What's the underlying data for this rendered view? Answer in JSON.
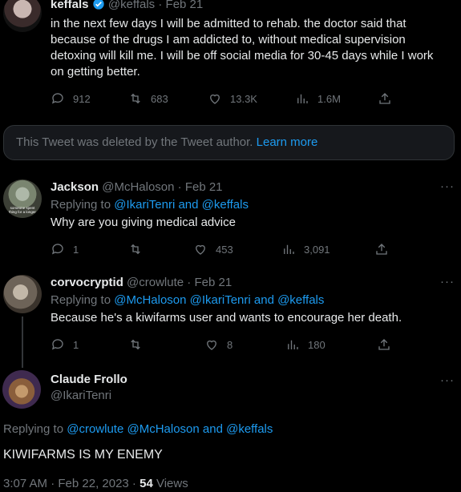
{
  "main_tweet": {
    "name": "keffals",
    "handle": "@keffals",
    "date": "Feb 21",
    "text_lines": [
      "in the next few days I will be admitted to rehab. the doctor said that",
      "because of the drugs I am addicted to, without medical supervision",
      "detoxing will kill me. I will be off social media for 30-45 days while I work",
      "on getting better."
    ],
    "replies": "912",
    "retweets": "683",
    "likes": "13.3K",
    "views": "1.6M"
  },
  "deleted": {
    "text": "This Tweet was deleted by the Tweet author.",
    "link": "Learn more"
  },
  "reply1": {
    "name": "Jackson",
    "handle": "@McHaloson",
    "date": "Feb 21",
    "replying_prefix": "Replying to ",
    "replying_to": "@IkariTenri and @keffals",
    "text": "Why are you giving medical advice",
    "replies": "1",
    "likes": "453",
    "views": "3,091",
    "avatar_caption": "someone spent thing for a longer"
  },
  "reply2": {
    "name": "corvocryptid",
    "handle": "@crowlute",
    "date": "Feb 21",
    "replying_prefix": "Replying to ",
    "replying_to": "@McHaloson @IkariTenri and @keffals",
    "text": "Because he's a kiwifarms user and wants to encourage her death.",
    "replies": "1",
    "likes": "8",
    "views": "180"
  },
  "focus": {
    "name": "Claude Frollo",
    "handle": "@IkariTenri",
    "replying_prefix": "Replying to ",
    "replying_to": "@crowlute @McHaloson and @keffals",
    "text": "KIWIFARMS IS MY ENEMY",
    "time": "3:07 AM · Feb 22, 2023 ·",
    "views_count": "54",
    "views_label": "Views"
  },
  "more_label": "···",
  "sep": " · ",
  "colors": {
    "bg": "#000000",
    "text": "#e7e9ea",
    "muted": "#71767b",
    "accent": "#1d9bf0"
  }
}
